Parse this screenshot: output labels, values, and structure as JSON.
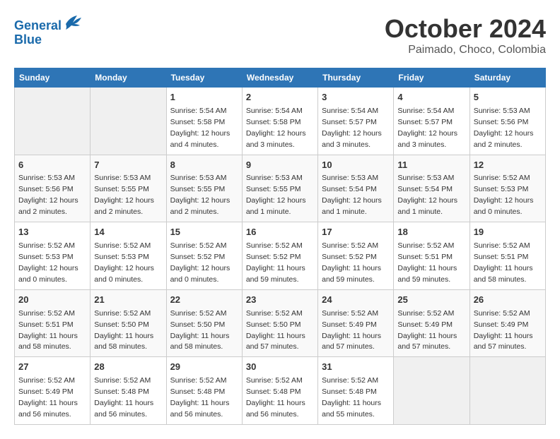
{
  "logo": {
    "line1": "General",
    "line2": "Blue"
  },
  "title": "October 2024",
  "subtitle": "Paimado, Choco, Colombia",
  "header_days": [
    "Sunday",
    "Monday",
    "Tuesday",
    "Wednesday",
    "Thursday",
    "Friday",
    "Saturday"
  ],
  "weeks": [
    [
      {
        "day": "",
        "info": ""
      },
      {
        "day": "",
        "info": ""
      },
      {
        "day": "1",
        "info": "Sunrise: 5:54 AM\nSunset: 5:58 PM\nDaylight: 12 hours and 4 minutes."
      },
      {
        "day": "2",
        "info": "Sunrise: 5:54 AM\nSunset: 5:58 PM\nDaylight: 12 hours and 3 minutes."
      },
      {
        "day": "3",
        "info": "Sunrise: 5:54 AM\nSunset: 5:57 PM\nDaylight: 12 hours and 3 minutes."
      },
      {
        "day": "4",
        "info": "Sunrise: 5:54 AM\nSunset: 5:57 PM\nDaylight: 12 hours and 3 minutes."
      },
      {
        "day": "5",
        "info": "Sunrise: 5:53 AM\nSunset: 5:56 PM\nDaylight: 12 hours and 2 minutes."
      }
    ],
    [
      {
        "day": "6",
        "info": "Sunrise: 5:53 AM\nSunset: 5:56 PM\nDaylight: 12 hours and 2 minutes."
      },
      {
        "day": "7",
        "info": "Sunrise: 5:53 AM\nSunset: 5:55 PM\nDaylight: 12 hours and 2 minutes."
      },
      {
        "day": "8",
        "info": "Sunrise: 5:53 AM\nSunset: 5:55 PM\nDaylight: 12 hours and 2 minutes."
      },
      {
        "day": "9",
        "info": "Sunrise: 5:53 AM\nSunset: 5:55 PM\nDaylight: 12 hours and 1 minute."
      },
      {
        "day": "10",
        "info": "Sunrise: 5:53 AM\nSunset: 5:54 PM\nDaylight: 12 hours and 1 minute."
      },
      {
        "day": "11",
        "info": "Sunrise: 5:53 AM\nSunset: 5:54 PM\nDaylight: 12 hours and 1 minute."
      },
      {
        "day": "12",
        "info": "Sunrise: 5:52 AM\nSunset: 5:53 PM\nDaylight: 12 hours and 0 minutes."
      }
    ],
    [
      {
        "day": "13",
        "info": "Sunrise: 5:52 AM\nSunset: 5:53 PM\nDaylight: 12 hours and 0 minutes."
      },
      {
        "day": "14",
        "info": "Sunrise: 5:52 AM\nSunset: 5:53 PM\nDaylight: 12 hours and 0 minutes."
      },
      {
        "day": "15",
        "info": "Sunrise: 5:52 AM\nSunset: 5:52 PM\nDaylight: 12 hours and 0 minutes."
      },
      {
        "day": "16",
        "info": "Sunrise: 5:52 AM\nSunset: 5:52 PM\nDaylight: 11 hours and 59 minutes."
      },
      {
        "day": "17",
        "info": "Sunrise: 5:52 AM\nSunset: 5:52 PM\nDaylight: 11 hours and 59 minutes."
      },
      {
        "day": "18",
        "info": "Sunrise: 5:52 AM\nSunset: 5:51 PM\nDaylight: 11 hours and 59 minutes."
      },
      {
        "day": "19",
        "info": "Sunrise: 5:52 AM\nSunset: 5:51 PM\nDaylight: 11 hours and 58 minutes."
      }
    ],
    [
      {
        "day": "20",
        "info": "Sunrise: 5:52 AM\nSunset: 5:51 PM\nDaylight: 11 hours and 58 minutes."
      },
      {
        "day": "21",
        "info": "Sunrise: 5:52 AM\nSunset: 5:50 PM\nDaylight: 11 hours and 58 minutes."
      },
      {
        "day": "22",
        "info": "Sunrise: 5:52 AM\nSunset: 5:50 PM\nDaylight: 11 hours and 58 minutes."
      },
      {
        "day": "23",
        "info": "Sunrise: 5:52 AM\nSunset: 5:50 PM\nDaylight: 11 hours and 57 minutes."
      },
      {
        "day": "24",
        "info": "Sunrise: 5:52 AM\nSunset: 5:49 PM\nDaylight: 11 hours and 57 minutes."
      },
      {
        "day": "25",
        "info": "Sunrise: 5:52 AM\nSunset: 5:49 PM\nDaylight: 11 hours and 57 minutes."
      },
      {
        "day": "26",
        "info": "Sunrise: 5:52 AM\nSunset: 5:49 PM\nDaylight: 11 hours and 57 minutes."
      }
    ],
    [
      {
        "day": "27",
        "info": "Sunrise: 5:52 AM\nSunset: 5:49 PM\nDaylight: 11 hours and 56 minutes."
      },
      {
        "day": "28",
        "info": "Sunrise: 5:52 AM\nSunset: 5:48 PM\nDaylight: 11 hours and 56 minutes."
      },
      {
        "day": "29",
        "info": "Sunrise: 5:52 AM\nSunset: 5:48 PM\nDaylight: 11 hours and 56 minutes."
      },
      {
        "day": "30",
        "info": "Sunrise: 5:52 AM\nSunset: 5:48 PM\nDaylight: 11 hours and 56 minutes."
      },
      {
        "day": "31",
        "info": "Sunrise: 5:52 AM\nSunset: 5:48 PM\nDaylight: 11 hours and 55 minutes."
      },
      {
        "day": "",
        "info": ""
      },
      {
        "day": "",
        "info": ""
      }
    ]
  ]
}
